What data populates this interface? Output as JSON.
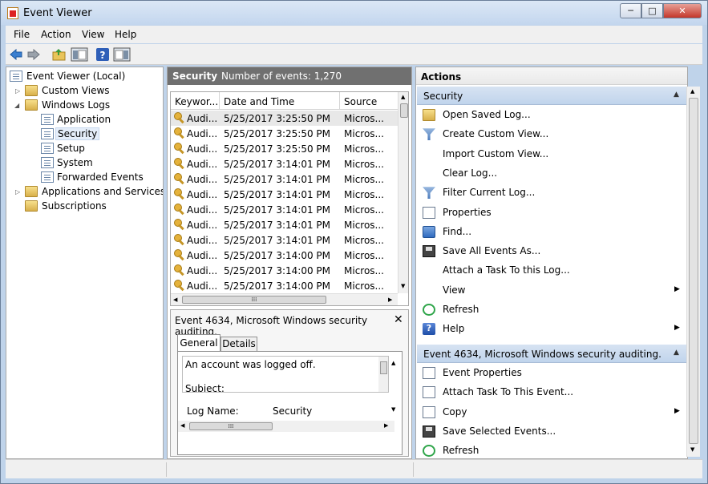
{
  "window": {
    "title": "Event Viewer",
    "min_glyph": "─",
    "max_glyph": "□",
    "close_glyph": "✕"
  },
  "menu": [
    "File",
    "Action",
    "View",
    "Help"
  ],
  "tree": {
    "root": "Event Viewer (Local)",
    "custom_views": "Custom Views",
    "windows_logs": "Windows Logs",
    "logs": [
      "Application",
      "Security",
      "Setup",
      "System",
      "Forwarded Events"
    ],
    "apps_services": "Applications and Services Lo",
    "subscriptions": "Subscriptions",
    "selected": "Security"
  },
  "middle": {
    "log_name": "Security",
    "event_count": "Number of events: 1,270",
    "columns": [
      "Keywor...",
      "Date and Time",
      "Source"
    ],
    "rows": [
      {
        "keyword": "Audi...",
        "date": "5/25/2017 3:25:50 PM",
        "source": "Micros..."
      },
      {
        "keyword": "Audi...",
        "date": "5/25/2017 3:25:50 PM",
        "source": "Micros..."
      },
      {
        "keyword": "Audi...",
        "date": "5/25/2017 3:25:50 PM",
        "source": "Micros..."
      },
      {
        "keyword": "Audi...",
        "date": "5/25/2017 3:14:01 PM",
        "source": "Micros..."
      },
      {
        "keyword": "Audi...",
        "date": "5/25/2017 3:14:01 PM",
        "source": "Micros..."
      },
      {
        "keyword": "Audi...",
        "date": "5/25/2017 3:14:01 PM",
        "source": "Micros..."
      },
      {
        "keyword": "Audi...",
        "date": "5/25/2017 3:14:01 PM",
        "source": "Micros..."
      },
      {
        "keyword": "Audi...",
        "date": "5/25/2017 3:14:01 PM",
        "source": "Micros..."
      },
      {
        "keyword": "Audi...",
        "date": "5/25/2017 3:14:01 PM",
        "source": "Micros..."
      },
      {
        "keyword": "Audi...",
        "date": "5/25/2017 3:14:00 PM",
        "source": "Micros..."
      },
      {
        "keyword": "Audi...",
        "date": "5/25/2017 3:14:00 PM",
        "source": "Micros..."
      },
      {
        "keyword": "Audi...",
        "date": "5/25/2017 3:14:00 PM",
        "source": "Micros..."
      }
    ],
    "detail": {
      "title": "Event 4634, Microsoft Windows security auditing.",
      "close": "✕",
      "tabs": [
        "General",
        "Details"
      ],
      "message": "An account was logged off.",
      "subject": "Subject:",
      "log_name_label": "Log Name:",
      "log_name_value": "Security"
    }
  },
  "actions": {
    "title": "Actions",
    "section1": "Security",
    "items1": [
      "Open Saved Log...",
      "Create Custom View...",
      "Import Custom View...",
      "Clear Log...",
      "Filter Current Log...",
      "Properties",
      "Find...",
      "Save All Events As...",
      "Attach a Task To this Log...",
      "View",
      "Refresh",
      "Help"
    ],
    "section2": "Event 4634, Microsoft Windows security auditing.",
    "items2": [
      "Event Properties",
      "Attach Task To This Event...",
      "Copy",
      "Save Selected Events...",
      "Refresh"
    ]
  },
  "glyphs": {
    "collapse": "▲",
    "submenu": "▶",
    "scroll_up": "▲",
    "scroll_down": "▼",
    "scroll_left": "◀",
    "scroll_right": "▶",
    "grip": "⁞⁞⁞"
  },
  "colors": {
    "mid_header": "#707070",
    "section": "#c9dbf0",
    "selected_row": "#e8e8e8"
  }
}
